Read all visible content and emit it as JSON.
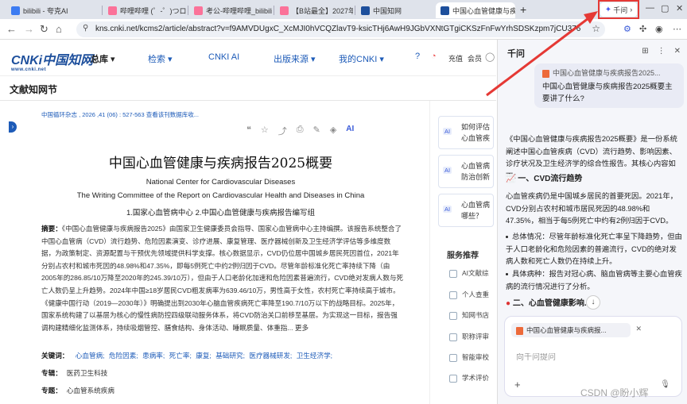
{
  "browser": {
    "tabs": [
      {
        "label": "bilibili - 夸克AI",
        "color": "#3d7cf2"
      },
      {
        "label": "哔哩哔哩 (゜-゜)つロ 干",
        "color": "#fb7299"
      },
      {
        "label": "考公-哔哩哔哩_bilibili",
        "color": "#fb7299"
      },
      {
        "label": "【B站最全】2027年公",
        "color": "#fb7299"
      },
      {
        "label": "中国知网",
        "color": "#1d4f9c"
      },
      {
        "label": "中国心血管健康与疾",
        "color": "#1d4f9c"
      }
    ],
    "qwen_button": "千问",
    "url": "kns.cnki.net/kcms2/article/abstract?v=f9AMVDUgxC_XcMJI0hVCQZlavT9-ksicTHj6AwH9JGbVXNtGTgiCKSzFnFwYrhSDSKzpm7jCU376fvpZUCi1gNiP_qN..."
  },
  "cnki": {
    "logo_main": "CNKi中国知网",
    "logo_sub": "www.cnki.net",
    "nav": [
      "总库",
      "检索",
      "CNKI AI",
      "出版来源",
      "我的CNKI"
    ],
    "right": [
      "充值",
      "会员"
    ],
    "site_title": "文献知网节"
  },
  "article": {
    "journal": "中国循环杂志 , 2026 ,41 (06) : 527-563  查看该刊数据库收...",
    "title": "中国心血管健康与疾病报告2025概要",
    "author_en": "National Center for Cardiovascular Diseases",
    "writing_en": "The Writing Committee of the Report on Cardiovascular Health and Diseases in China",
    "affiliations": "1.国家心血管病中心     2.中国心血管健康与疾病报告编写组",
    "abstract_label": "摘要：",
    "abstract": "《中国心血管健康与疾病报告2025》由国家卫生健康委员会指导、国家心血管病中心主持编撰。该报告系统整合了中国心血管病（CVD）流行趋势、危险因素演变、诊疗进展、康复管理、医疗器械创新及卫生经济学评估等多维度数据，为政策制定、资源配置与干预优先领域提供科学支撑。核心数据显示，CVD仍位居中国城乡居民死因首位，2021年分别占农村和城市死因的48.98%和47.35%，即每5例死亡中约2例归因于CVD。尽管年龄标准化死亡率持续下降（由2005年的286.85/10万降至2020年的245.39/10万），但由于人口老龄化加速和危险因素普遍流行，CVD绝对发病人数与死亡人数仍呈上升趋势。2024年中国≥18岁居民CVD粗发病率为639.46/10万，男性高于女性，农村死亡率持续高于城市。《健康中国行动（2019—2030年）》明确提出到2030年心脑血管疾病死亡率降至190.7/10万以下的战略目标。2025年，国家系统构建了以基层为核心的慢性病防控四级联动服务体系，将CVD防治关口前移至基层。为实现这一目标，报告强调构建精细化监测体系，持续吸烟管控、膳食结构、身体活动、睡眠质量、体重指... 更多",
    "keywords_label": "关键词：",
    "keywords": [
      "心血管病;",
      "危险因素;",
      "患病率;",
      "死亡率;",
      "康复;",
      "基础研究;",
      "医疗器械研发;",
      "卫生经济学;"
    ],
    "topic_label": "专辑：",
    "topic": "医药卫生科技",
    "subject_label": "专题：",
    "subject": "心血管系统疾病"
  },
  "sidebar": {
    "ai_badge": "AI",
    "cards": [
      "如何评估心血管疾病对经济学影响？",
      "心血管病防治创新与进展？",
      "心血管病哪些？"
    ],
    "services_title": "服务推荐",
    "services": [
      "AI文献综",
      "个人查重",
      "知网书店",
      "职称评审",
      "智能审校",
      "学术评价"
    ]
  },
  "qwen": {
    "title": "千问",
    "ref_file": "中国心血管健康与疾病报告2025...",
    "question": "中国心血管健康与疾病报告2025概要主要讲了什么?",
    "answer_intro": "《中国心血管健康与疾病报告2025概要》是一份系统阐述中国心血管疾病（CVD）流行趋势、影响因素、诊疗状况及卫生经济学的综合性报告。其核心内容如下：",
    "section1": "一、CVD流行趋势",
    "para1": "心血管疾病仍是中国城乡居民的首要死因。2021年，CVD分别占农村和城市居民死因的48.98%和47.35%，相当于每5例死亡中约有2例归因于CVD。",
    "bullets": [
      "总体情况：尽管年龄标准化死亡率呈下降趋势，但由于人口老龄化和危险因素的普遍流行，CVD的绝对发病人数和死亡人数仍在持续上升。",
      "具体病种：报告对冠心病、脑血管病等主要心血管疾病的流行情况进行了分析。"
    ],
    "section2": "二、心血管健康影响...",
    "chip_file": "中国心血管健康与疾病报...",
    "input_placeholder": "向千问提问",
    "watermark": "CSDN @盼小辉"
  }
}
